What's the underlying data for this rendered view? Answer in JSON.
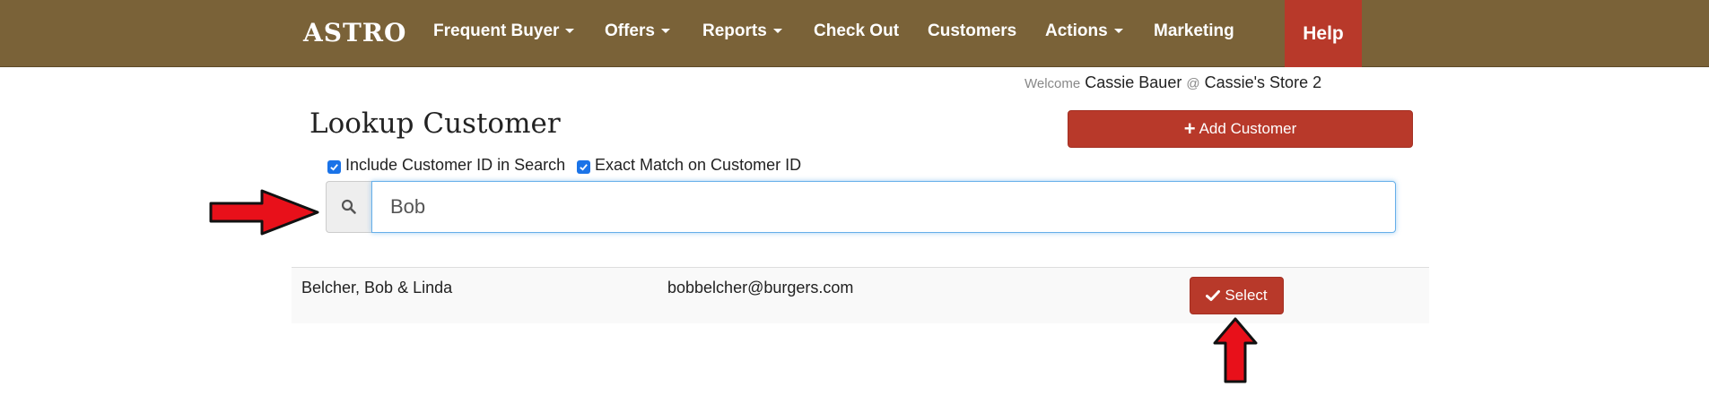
{
  "navbar": {
    "brand": "ASTRO",
    "items": [
      {
        "label": "Frequent Buyer",
        "dropdown": true
      },
      {
        "label": "Offers",
        "dropdown": true
      },
      {
        "label": "Reports",
        "dropdown": true
      },
      {
        "label": "Check Out",
        "dropdown": false
      },
      {
        "label": "Customers",
        "dropdown": false
      },
      {
        "label": "Actions",
        "dropdown": true
      },
      {
        "label": "Marketing",
        "dropdown": false
      }
    ],
    "help_label": "Help"
  },
  "welcome": {
    "prefix": "Welcome",
    "user": "Cassie Bauer",
    "at": "@",
    "store": "Cassie's Store 2"
  },
  "page": {
    "title": "Lookup Customer",
    "add_button": "Add Customer"
  },
  "options": {
    "include_id_label": "Include Customer ID in Search",
    "include_id_checked": true,
    "exact_match_label": "Exact Match on Customer ID",
    "exact_match_checked": true
  },
  "search": {
    "value": "Bob",
    "icon": "search-icon"
  },
  "results": [
    {
      "name": "Belcher, Bob & Linda",
      "email": "bobbelcher@burgers.com",
      "action": "Select"
    }
  ],
  "colors": {
    "navbar": "#7a6238",
    "accent": "#b8392a",
    "annotation_arrow": "#e8101a"
  }
}
